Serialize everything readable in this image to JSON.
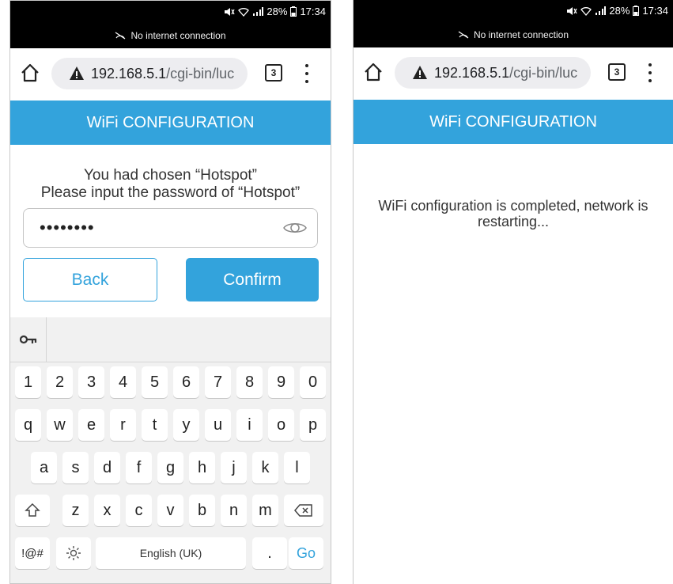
{
  "left_phone": {
    "status": {
      "battery": "28%",
      "time": "17:34",
      "no_internet": "No internet connection"
    },
    "browser": {
      "url_host": "192.168.5.1",
      "url_path": "/cgi-bin/luc",
      "tab_count": "3"
    },
    "title": "WiFi CONFIGURATION",
    "chosen_line1": "You had chosen “Hotspot”",
    "chosen_line2": "Please input the password of “Hotspot”",
    "password_value": "••••••••",
    "back_label": "Back",
    "confirm_label": "Confirm",
    "keyboard": {
      "number_row": [
        "1",
        "2",
        "3",
        "4",
        "5",
        "6",
        "7",
        "8",
        "9",
        "0"
      ],
      "row1": [
        "q",
        "w",
        "e",
        "r",
        "t",
        "y",
        "u",
        "i",
        "o",
        "p"
      ],
      "row2": [
        "a",
        "s",
        "d",
        "f",
        "g",
        "h",
        "j",
        "k",
        "l"
      ],
      "row3": [
        "z",
        "x",
        "c",
        "v",
        "b",
        "n",
        "m"
      ],
      "symbols_label": "!@#",
      "space_label": "English (UK)",
      "period_label": ".",
      "go_label": "Go"
    }
  },
  "right_phone": {
    "status": {
      "battery": "28%",
      "time": "17:34",
      "no_internet": "No internet connection"
    },
    "browser": {
      "url_host": "192.168.5.1",
      "url_path": "/cgi-bin/luc",
      "tab_count": "3"
    },
    "title": "WiFi CONFIGURATION",
    "message_line1": "WiFi configuration is completed, network is",
    "message_line2": "restarting..."
  },
  "colors": {
    "accent": "#33a3dc",
    "status_bar": "#000000",
    "url_pill": "#ededf0",
    "keyboard_bg": "#f1f1f1"
  }
}
